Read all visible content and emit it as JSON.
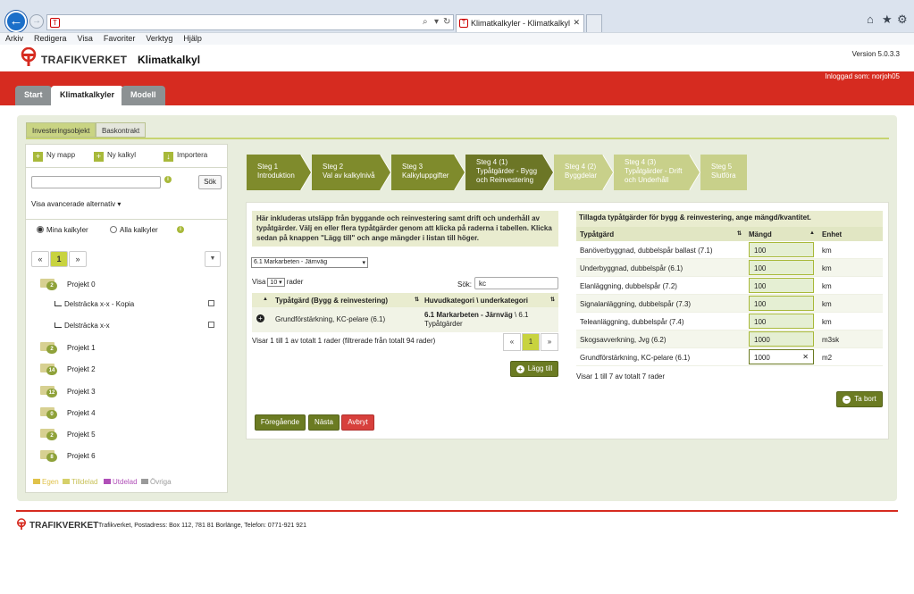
{
  "browser": {
    "tab_title": "Klimatkalkyler - Klimatkalkyl",
    "menu": [
      "Arkiv",
      "Redigera",
      "Visa",
      "Favoriter",
      "Verktyg",
      "Hjälp"
    ]
  },
  "app": {
    "brand": "TRAFIKVERKET",
    "name": "Klimatkalkyl",
    "version": "Version 5.0.3.3",
    "logged_in": "Inloggad som: norjoh05",
    "main_tabs": [
      "Start",
      "Klimatkalkyler",
      "Modell"
    ]
  },
  "subtabs": [
    "Investeringsobjekt",
    "Baskontrakt"
  ],
  "sidebar": {
    "buttons": [
      "Ny mapp",
      "Ny kalkyl",
      "Importera"
    ],
    "search_button": "Sök",
    "advanced": "Visa avancerade alternativ",
    "radio_mine": "Mina kalkyler",
    "radio_all": "Alla kalkyler",
    "pager": {
      "prev": "«",
      "current": "1",
      "next": "»"
    },
    "projects": [
      {
        "name": "Projekt 0",
        "count": "2"
      },
      {
        "name": "Projekt 1",
        "count": "2"
      },
      {
        "name": "Projekt 2",
        "count": "14"
      },
      {
        "name": "Projekt 3",
        "count": "12"
      },
      {
        "name": "Projekt 4",
        "count": "0"
      },
      {
        "name": "Projekt 5",
        "count": "2"
      },
      {
        "name": "Projekt 6",
        "count": "8"
      }
    ],
    "calcs": [
      "Delsträcka x-x - Kopia",
      "Delsträcka x-x"
    ],
    "legend": [
      "Egen",
      "Tilldelad",
      "Utdelad",
      "Övriga"
    ],
    "legend_colors": [
      "#e0c24a",
      "#d6d06a",
      "#b04fb8",
      "#9a9a9a"
    ]
  },
  "wizard": [
    {
      "l1": "Steg 1",
      "l2": "Introduktion",
      "l3": ""
    },
    {
      "l1": "Steg 2",
      "l2": "Val av kalkylnivå",
      "l3": ""
    },
    {
      "l1": "Steg 3",
      "l2": "Kalkyluppgifter",
      "l3": ""
    },
    {
      "l1": "Steg 4 (1)",
      "l2": "Typåtgärder - Bygg",
      "l3": "och Reinvestering"
    },
    {
      "l1": "Steg 4 (2)",
      "l2": "Byggdelar",
      "l3": ""
    },
    {
      "l1": "Steg 4 (3)",
      "l2": "Typåtgärder - Drift",
      "l3": "och Underhåll"
    },
    {
      "l1": "Steg 5",
      "l2": "Slutföra",
      "l3": ""
    }
  ],
  "mid": {
    "description": "Här inkluderas utsläpp från byggande och reinvestering samt drift och underhåll av typåtgärder. Välj en eller flera typåtgärder genom att klicka på raderna i tabellen. Klicka sedan på knappen \"Lägg till\" och ange mängder i listan till höger.",
    "category_select": "6.1 Markarbeten - Järnväg",
    "show_label": "Visa",
    "show_value": "10",
    "rows_label": "rader",
    "search_label": "Sök:",
    "search_value": "kc",
    "col1": "Typåtgärd (Bygg & reinvestering)",
    "col2": "Huvudkategori \\ underkategori",
    "row": {
      "name": "Grundförstärkning, KC-pelare (6.1)",
      "cat_bold": "6.1 Markarbeten - Järnväg",
      "cat_rest": " \\ 6.1 Typåtgärder"
    },
    "info": "Visar 1 till 1 av totalt 1 rader (filtrerade från totalt 94 rader)",
    "pager": {
      "prev": "«",
      "current": "1",
      "next": "»"
    },
    "add_button": "Lägg till",
    "prev_button": "Föregående",
    "next_button": "Nästa",
    "cancel_button": "Avbryt"
  },
  "right": {
    "title": "Tillagda typåtgärder för bygg & reinvestering, ange mängd/kvantitet.",
    "col1": "Typåtgärd",
    "col2": "Mängd",
    "col3": "Enhet",
    "rows": [
      {
        "name": "Banöverbyggnad, dubbelspår ballast (7.1)",
        "qty": "100",
        "unit": "km"
      },
      {
        "name": "Underbyggnad, dubbelspår (6.1)",
        "qty": "100",
        "unit": "km"
      },
      {
        "name": "Elanläggning, dubbelspår (7.2)",
        "qty": "100",
        "unit": "km"
      },
      {
        "name": "Signalanläggning, dubbelspår (7.3)",
        "qty": "100",
        "unit": "km"
      },
      {
        "name": "Teleanläggning, dubbelspår (7.4)",
        "qty": "100",
        "unit": "km"
      },
      {
        "name": "Skogsavverkning, Jvg (6.2)",
        "qty": "1000",
        "unit": "m3sk"
      },
      {
        "name": "Grundförstärkning, KC-pelare (6.1)",
        "qty": "1000",
        "unit": "m2"
      }
    ],
    "info": "Visar 1 till 7 av totalt 7 rader",
    "remove_button": "Ta bort"
  },
  "footer": {
    "brand": "TRAFIKVERKET",
    "address": "Trafikverket, Postadress: Box 112, 781 81 Borlänge, Telefon: 0771-921 921"
  }
}
